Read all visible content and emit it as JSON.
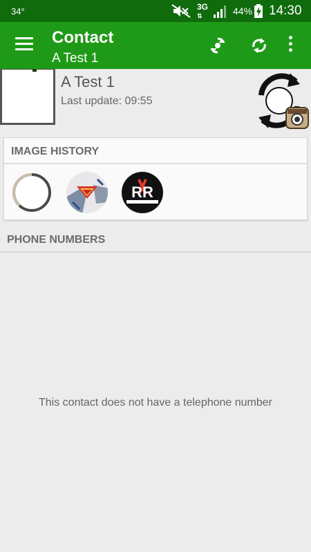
{
  "status_bar": {
    "temperature": "34°",
    "network": "3G",
    "battery": "44%",
    "time": "14:30",
    "icons": [
      "mute-icon",
      "signal-icon",
      "battery-charging-icon"
    ]
  },
  "app_bar": {
    "title": "Contact",
    "subtitle": "A Test 1",
    "icons": [
      "menu-icon",
      "sync-photo-icon",
      "refresh-icon",
      "overflow-menu-icon"
    ],
    "color": "#1f9a18",
    "status_color": "#0f6b0c"
  },
  "contact": {
    "name": "A Test 1",
    "last_update": "Last update: 09:55"
  },
  "image_history": {
    "header": "IMAGE HISTORY",
    "items": [
      {
        "name": "history-image-ring"
      },
      {
        "name": "history-image-superman"
      },
      {
        "name": "history-image-rr-logo",
        "text": "RR"
      }
    ]
  },
  "phone_numbers": {
    "header": "PHONE NUMBERS",
    "empty_message": "This contact does not have a telephone number"
  }
}
